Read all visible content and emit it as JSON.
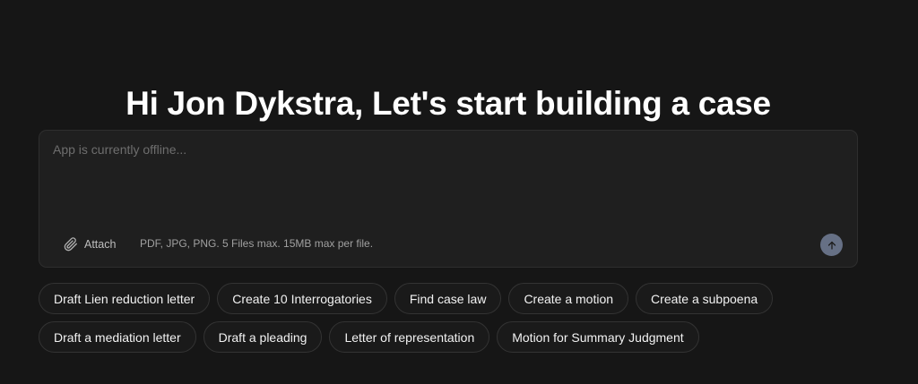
{
  "header": {
    "title": "Hi Jon Dykstra, Let's start building a case"
  },
  "composer": {
    "placeholder": "App is currently offline...",
    "attach_label": "Attach",
    "file_hint": "PDF, JPG, PNG. 5 Files max. 15MB max per file.",
    "send_icon": "arrow-up-icon",
    "attach_icon": "paperclip-icon",
    "send_color": "#667085"
  },
  "suggestions": {
    "row1": [
      "Draft Lien reduction letter",
      "Create 10 Interrogatories",
      "Find case law",
      "Create a motion",
      "Create a subpoena"
    ],
    "row2": [
      "Draft a mediation letter",
      "Draft a pleading",
      "Letter of representation",
      "Motion for Summary Judgment"
    ]
  }
}
